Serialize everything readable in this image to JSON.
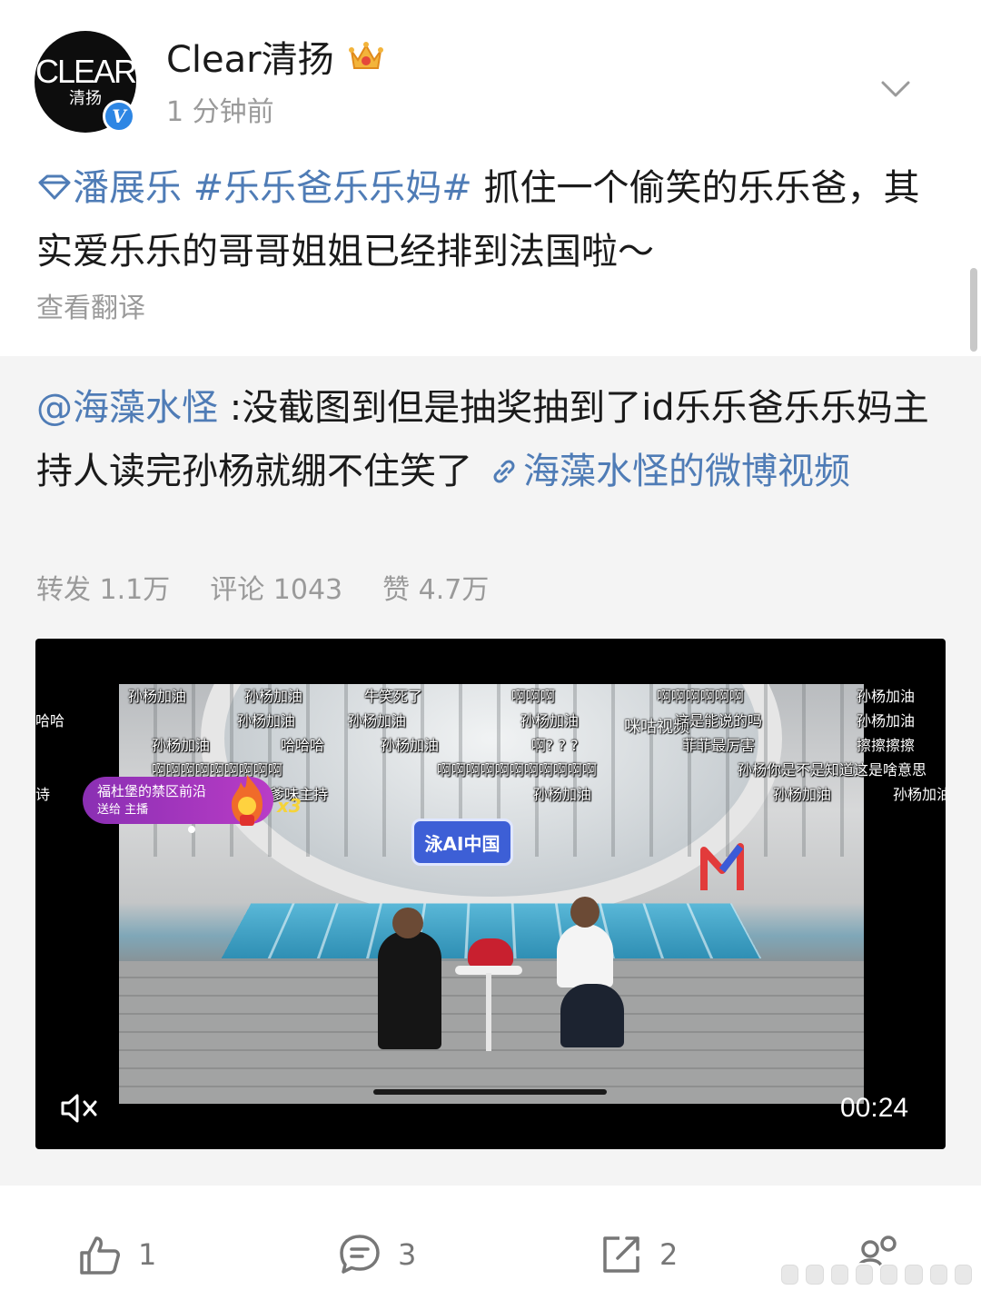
{
  "author": {
    "avatar_brand": "CLEAR",
    "avatar_brand_cn": "清扬",
    "verified_mark": "V",
    "name": "Clear清扬",
    "time": "1 分钟前"
  },
  "post": {
    "topic_icon": "diamond-icon",
    "topic_1": "潘展乐",
    "topic_2": "#乐乐爸乐乐妈#",
    "text": " 抓住一个偷笑的乐乐爸，其实爱乐乐的哥哥姐姐已经排到法国啦～",
    "translate_label": "查看翻译"
  },
  "repost": {
    "mention": "@海藻水怪",
    "text": " :没截图到但是抽奖抽到了id乐乐爸乐乐妈主持人读完孙杨就绷不住笑了",
    "link_text": "海藻水怪的微博视频",
    "stats": {
      "repost": "转发 1.1万",
      "comment": "评论 1043",
      "like": "赞 4.7万"
    }
  },
  "video": {
    "duration": "00:24",
    "logo_text": "泳AI中国",
    "gift_line1": "福杜堡的禁区前沿",
    "gift_line2": "送给 主播",
    "gift_count": "x3",
    "danmaku": [
      "孙杨加油",
      "孙杨加油",
      "牛笑死了",
      "啊啊啊",
      "啊啊啊啊啊啊",
      "孙杨加油",
      "哈哈",
      "孙杨加油",
      "孙杨加油",
      "孙杨加油",
      "这是能说的吗",
      "孙杨加油",
      "孙杨加油",
      "哈哈哈",
      "孙杨加油",
      "啊? ? ?",
      "菲菲最厉害",
      "擦擦擦擦",
      "啊啊啊啊啊啊啊啊啊",
      "啊啊啊啊啊啊啊啊啊啊啊",
      "孙杨你是不是知道这是啥意思",
      "诗",
      "怎么又是你这个爹味主持",
      "孙杨加油",
      "孙杨加油",
      "孙杨加油"
    ],
    "watermark": "咪咕视频"
  },
  "actions": {
    "like_count": "1",
    "comment_count": "3",
    "share_count": "2"
  },
  "colors": {
    "link": "#4f7cb6",
    "muted": "#9a9a9a",
    "repost_bg": "#f4f4f4",
    "verified": "#2d86e4"
  }
}
